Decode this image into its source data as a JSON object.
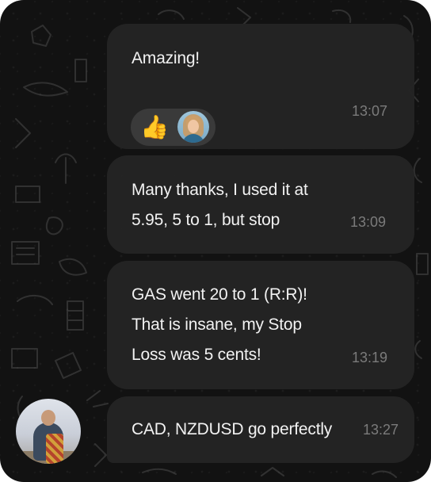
{
  "messages": [
    {
      "text": "Amazing!",
      "time": "13:07",
      "reaction": {
        "emoji": "👍",
        "icon": "thumbs-up-icon"
      }
    },
    {
      "text": "Many thanks, I used it at\n5.95, 5 to 1, but stop",
      "time": "13:09"
    },
    {
      "text": "GAS went 20 to 1 (R:R)!\nThat is insane, my Stop\nLoss was 5 cents!",
      "time": "13:19"
    },
    {
      "text": "CAD, NZDUSD go perfectly",
      "time": "13:27"
    }
  ],
  "colors": {
    "background": "#121212",
    "bubble": "#242424",
    "text": "#f2f2f2",
    "time": "#7b7b7b",
    "reaction_pill": "#3a3a3a"
  }
}
